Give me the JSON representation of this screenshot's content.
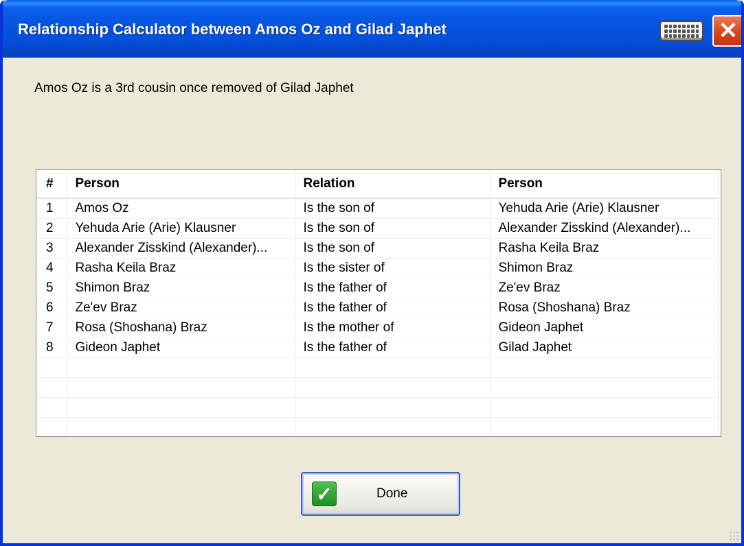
{
  "window": {
    "title": "Relationship Calculator between Amos Oz and Gilad Japhet"
  },
  "summary": "Amos Oz is a 3rd cousin once removed of Gilad Japhet",
  "table": {
    "headers": [
      "#",
      "Person",
      "Relation",
      "Person"
    ],
    "rows": [
      [
        "1",
        "Amos Oz",
        "Is the son of",
        "Yehuda Arie (Arie) Klausner"
      ],
      [
        "2",
        "Yehuda Arie (Arie) Klausner",
        "Is the son of",
        "Alexander Zisskind (Alexander)..."
      ],
      [
        "3",
        "Alexander Zisskind (Alexander)...",
        "Is the son of",
        "Rasha Keila Braz"
      ],
      [
        "4",
        "Rasha Keila Braz",
        "Is the sister of",
        "Shimon Braz"
      ],
      [
        "5",
        "Shimon Braz",
        "Is the father of",
        "Ze'ev Braz"
      ],
      [
        "6",
        "Ze'ev Braz",
        "Is the father of",
        "Rosa (Shoshana) Braz"
      ],
      [
        "7",
        "Rosa (Shoshana) Braz",
        "Is the mother of",
        "Gideon Japhet"
      ],
      [
        "8",
        "Gideon Japhet",
        "Is the father of",
        "Gilad Japhet"
      ]
    ]
  },
  "buttons": {
    "done_label": "Done"
  },
  "icons": {
    "keyboard": "keyboard-icon",
    "close": "close-icon",
    "check": "checkmark-icon"
  }
}
